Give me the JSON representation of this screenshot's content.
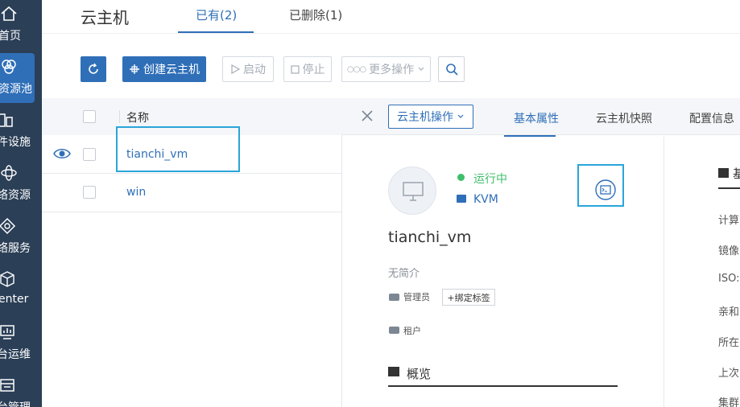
{
  "sidebar": {
    "items": [
      {
        "label": "首页",
        "icon": "home-icon"
      },
      {
        "label": "资源池",
        "icon": "resource-pool-icon",
        "active": true
      },
      {
        "label": "件设施",
        "icon": "hardware-icon"
      },
      {
        "label": "络资源",
        "icon": "network-resource-icon"
      },
      {
        "label": "络服务",
        "icon": "network-service-icon"
      },
      {
        "label": "enter",
        "icon": "cube-icon"
      },
      {
        "label": "台运维",
        "icon": "monitor-icon"
      },
      {
        "label": "台管理",
        "icon": "management-icon"
      }
    ]
  },
  "header": {
    "title": "云主机",
    "tabs": [
      {
        "label": "已有(2)",
        "active": true
      },
      {
        "label": "已删除(1)",
        "active": false
      }
    ]
  },
  "toolbar": {
    "create_label": "创建云主机",
    "start_label": "启动",
    "stop_label": "停止",
    "more_label": "更多操作"
  },
  "list": {
    "column_name": "名称",
    "rows": [
      {
        "name": "tianchi_vm",
        "selected": true
      },
      {
        "name": "win",
        "selected": false
      }
    ]
  },
  "detail": {
    "ops_label": "云主机操作",
    "tabs": [
      "基本属性",
      "云主机快照",
      "配置信息"
    ],
    "status": "运行中",
    "hypervisor": "KVM",
    "name": "tianchi_vm",
    "description": "无简介",
    "owner_label": "管理员",
    "bind_tag_label": "+绑定标签",
    "tenant_label": "租户",
    "overview_label": "概览",
    "right_heading": "基",
    "right_labels": [
      "计算",
      "镜像",
      "ISO:",
      "亲和",
      "所在",
      "上次",
      "集群"
    ]
  },
  "colors": {
    "sidebar_bg": "#2b3f57",
    "accent": "#2f6fb8",
    "running": "#3fbf6b",
    "highlight": "#2aa5d9"
  }
}
